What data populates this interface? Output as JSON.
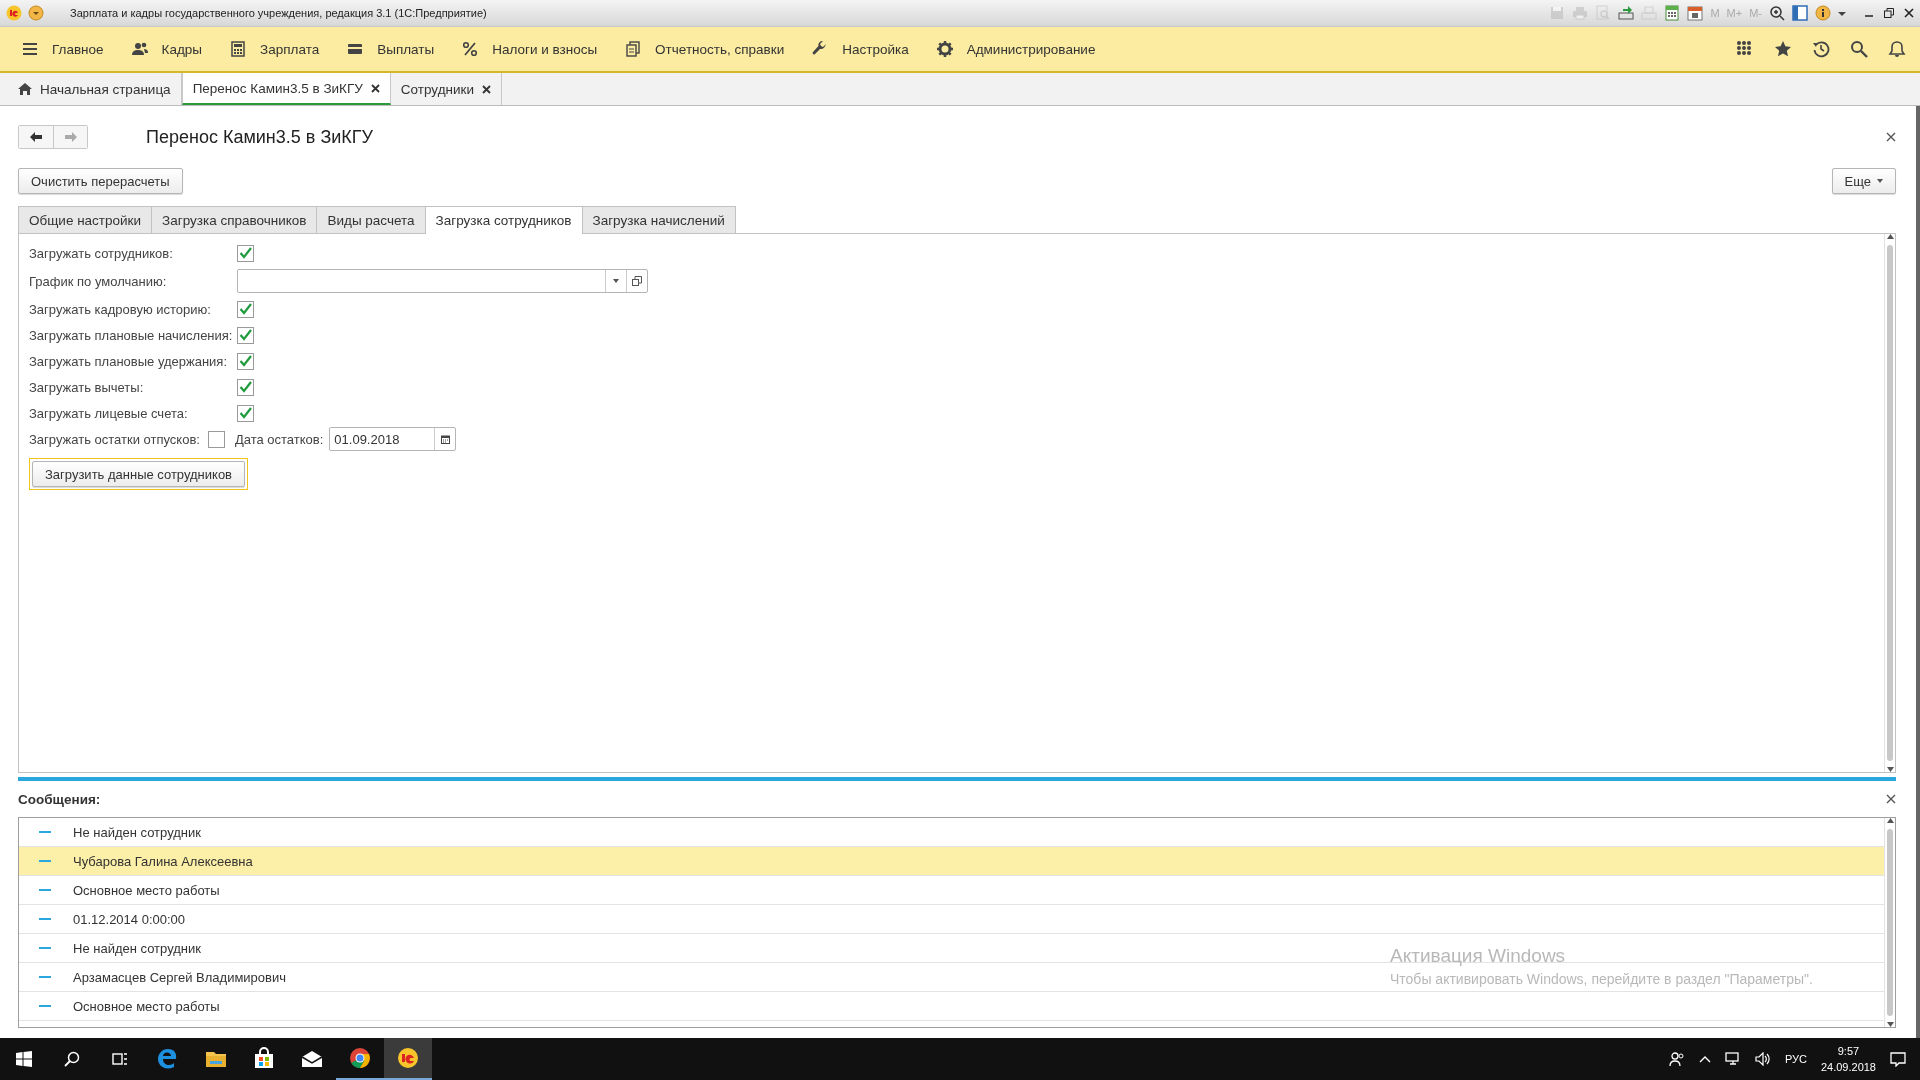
{
  "window": {
    "title": "Зарплата и кадры государственного учреждения, редакция 3.1  (1С:Предприятие)"
  },
  "title_tools": [
    {
      "kind": "icon",
      "disabled": true
    },
    {
      "kind": "icon",
      "disabled": true
    },
    {
      "kind": "icon",
      "disabled": true
    },
    {
      "kind": "icon",
      "disabled": false
    },
    {
      "kind": "icon",
      "disabled": true
    },
    {
      "kind": "icon",
      "disabled": false
    },
    {
      "kind": "icon",
      "disabled": false
    },
    {
      "kind": "text",
      "label": "M",
      "disabled": true
    },
    {
      "kind": "text",
      "label": "M+",
      "disabled": true
    },
    {
      "kind": "text",
      "label": "M-",
      "disabled": true
    },
    {
      "kind": "icon",
      "disabled": false
    },
    {
      "kind": "icon",
      "disabled": false
    },
    {
      "kind": "icon",
      "disabled": false
    }
  ],
  "sections": [
    {
      "label": "Главное"
    },
    {
      "label": "Кадры"
    },
    {
      "label": "Зарплата"
    },
    {
      "label": "Выплаты"
    },
    {
      "label": "Налоги и взносы"
    },
    {
      "label": "Отчетность, справки"
    },
    {
      "label": "Настройка"
    },
    {
      "label": "Администрирование"
    }
  ],
  "open_tabs": [
    {
      "kind": "home",
      "label": "Начальная страница",
      "selected": false
    },
    {
      "kind": "closable",
      "label": "Перенос Камин3.5 в ЗиКГУ",
      "selected": true
    },
    {
      "kind": "closable",
      "label": "Сотрудники",
      "selected": false
    }
  ],
  "form": {
    "title": "Перенос Камин3.5 в ЗиКГУ",
    "clear_button": "Очистить перерасчеты",
    "more_button": "Еще",
    "tabs": [
      {
        "label": "Общие настройки",
        "selected": false
      },
      {
        "label": "Загрузка справочников",
        "selected": false
      },
      {
        "label": "Виды расчета",
        "selected": false
      },
      {
        "label": "Загрузка сотрудников",
        "selected": true
      },
      {
        "label": "Загрузка начислений",
        "selected": false
      }
    ],
    "fields": [
      {
        "kind": "checkbox",
        "label": "Загружать сотрудников:",
        "checked": true
      },
      {
        "kind": "select",
        "label": "График по умолчанию:"
      },
      {
        "kind": "checkbox",
        "label": "Загружать кадровую историю:",
        "checked": true
      },
      {
        "kind": "checkbox",
        "label": "Загружать плановые начисления:",
        "checked": true
      },
      {
        "kind": "checkbox",
        "label": "Загружать плановые удержания:",
        "checked": true
      },
      {
        "kind": "checkbox",
        "label": "Загружать вычеты:",
        "checked": true
      },
      {
        "kind": "checkbox",
        "label": "Загружать лицевые счета:",
        "checked": true
      },
      {
        "kind": "checkbox_date",
        "label": "Загружать остатки отпусков:",
        "checked": false,
        "date_label": "Дата остатков:",
        "date_value": "01.09.2018"
      }
    ],
    "load_button": {
      "label": "Загрузить данные сотрудников",
      "focused": true
    }
  },
  "messages": {
    "title": "Сообщения:",
    "items": [
      {
        "text": "Не найден сотрудник",
        "selected": false
      },
      {
        "text": "Чубарова Галина Алексеевна",
        "selected": true
      },
      {
        "text": "Основное место работы",
        "selected": false
      },
      {
        "text": "01.12.2014 0:00:00",
        "selected": false
      },
      {
        "text": "Не найден сотрудник",
        "selected": false
      },
      {
        "text": "Арзамасцев Сергей Владимирович",
        "selected": false
      },
      {
        "text": "Основное место работы",
        "selected": false
      }
    ]
  },
  "activation_notice": {
    "title": "Активация Windows",
    "text": "Чтобы активировать Windows, перейдите в раздел \"Параметры\"."
  },
  "taskbar": {
    "apps": [
      {
        "running": false,
        "selected": false
      },
      {
        "running": false,
        "selected": false
      },
      {
        "running": false,
        "selected": false
      },
      {
        "running": false,
        "selected": false
      },
      {
        "running": true,
        "selected": false
      },
      {
        "running": true,
        "selected": true
      }
    ],
    "language": "РУС",
    "time": "9:57",
    "date": "24.09.2018"
  }
}
